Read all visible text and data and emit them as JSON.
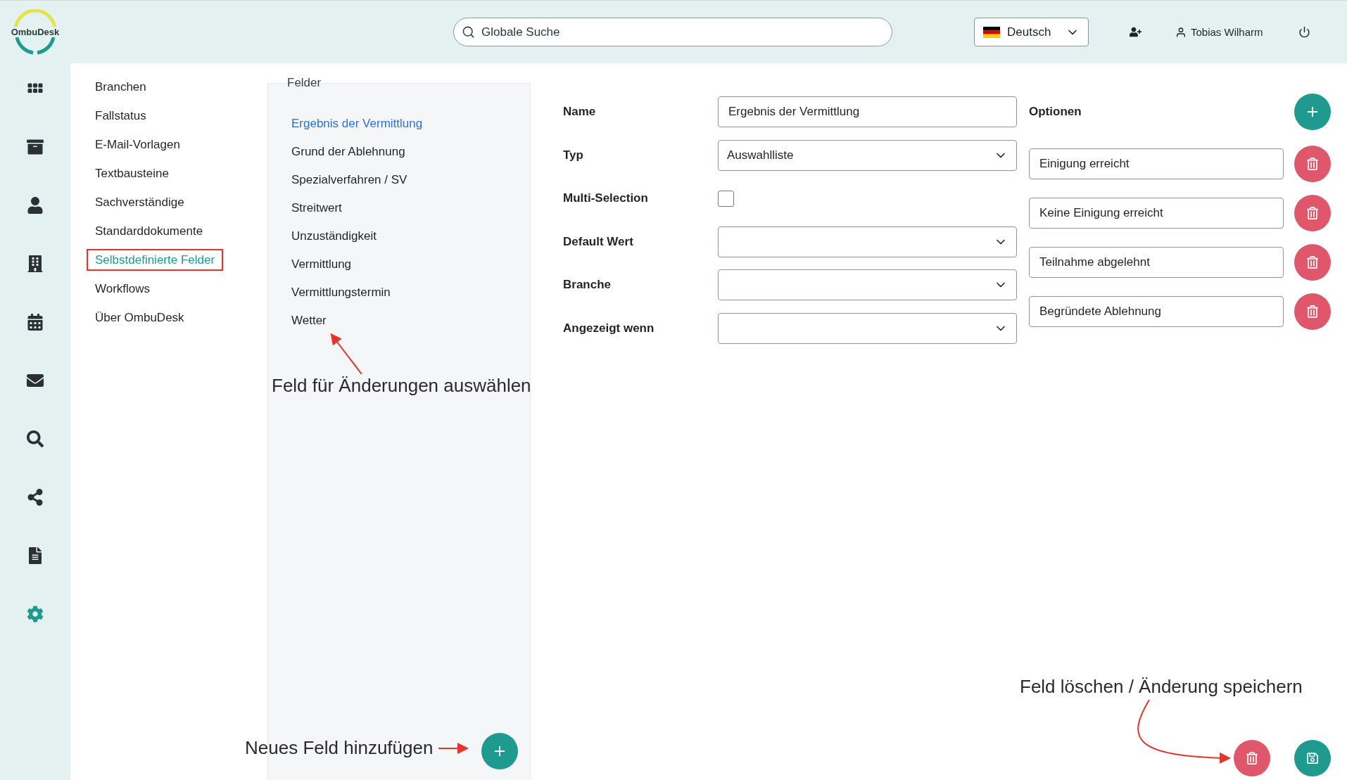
{
  "header": {
    "logo": "OmbuDesk",
    "search": {
      "placeholder": "Globale Suche"
    },
    "language": "Deutsch",
    "user": "Tobias Wilharm"
  },
  "nav_rail": [
    {
      "selected": false
    },
    {
      "selected": false
    },
    {
      "selected": false
    },
    {
      "selected": false
    },
    {
      "selected": false
    },
    {
      "selected": false
    },
    {
      "selected": false
    },
    {
      "selected": false
    },
    {
      "selected": false
    },
    {
      "selected": true
    }
  ],
  "settings_menu": [
    {
      "label": "Branchen",
      "selected": false
    },
    {
      "label": "Fallstatus",
      "selected": false
    },
    {
      "label": "E-Mail-Vorlagen",
      "selected": false
    },
    {
      "label": "Textbausteine",
      "selected": false
    },
    {
      "label": "Sachverständige",
      "selected": false
    },
    {
      "label": "Standarddokumente",
      "selected": false
    },
    {
      "label": "Selbstdefinierte Felder",
      "selected": true
    },
    {
      "label": "Workflows",
      "selected": false
    },
    {
      "label": "Über OmbuDesk",
      "selected": false
    }
  ],
  "fields_panel": {
    "title": "Felder",
    "items": [
      {
        "label": "Ergebnis der Vermittlung",
        "selected": true
      },
      {
        "label": "Grund der Ablehnung",
        "selected": false
      },
      {
        "label": "Spezialverfahren / SV",
        "selected": false
      },
      {
        "label": "Streitwert",
        "selected": false
      },
      {
        "label": "Unzuständigkeit",
        "selected": false
      },
      {
        "label": "Vermittlung",
        "selected": false
      },
      {
        "label": "Vermittlungstermin",
        "selected": false
      },
      {
        "label": "Wetter",
        "selected": false
      }
    ]
  },
  "form": [
    {
      "label": "Name",
      "kind": "text",
      "value": "Ergebnis der Vermittlung"
    },
    {
      "label": "Typ",
      "kind": "select",
      "value": "Auswahlliste"
    },
    {
      "label": "Multi-Selection",
      "kind": "checkbox",
      "checked": false
    },
    {
      "label": "Default Wert",
      "kind": "select"
    },
    {
      "label": "Branche",
      "kind": "select"
    },
    {
      "label": "Angezeigt wenn",
      "kind": "select"
    }
  ],
  "options": {
    "title": "Optionen",
    "items": [
      "Einigung erreicht",
      "Keine Einigung erreicht",
      "Teilnahme abgelehnt",
      "Begründete Ablehnung"
    ]
  },
  "annotations": [
    "Feld für Änderungen auswählen",
    "Neues Feld hinzufügen",
    "Feld löschen / Änderung speichern"
  ]
}
